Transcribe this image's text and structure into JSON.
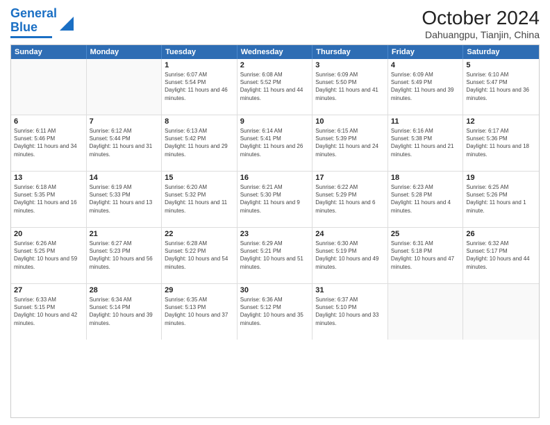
{
  "header": {
    "logo_general": "General",
    "logo_blue": "Blue",
    "title": "October 2024",
    "subtitle": "Dahuangpu, Tianjin, China"
  },
  "days": [
    "Sunday",
    "Monday",
    "Tuesday",
    "Wednesday",
    "Thursday",
    "Friday",
    "Saturday"
  ],
  "weeks": [
    [
      {
        "day": "",
        "info": ""
      },
      {
        "day": "",
        "info": ""
      },
      {
        "day": "1",
        "info": "Sunrise: 6:07 AM\nSunset: 5:54 PM\nDaylight: 11 hours and 46 minutes."
      },
      {
        "day": "2",
        "info": "Sunrise: 6:08 AM\nSunset: 5:52 PM\nDaylight: 11 hours and 44 minutes."
      },
      {
        "day": "3",
        "info": "Sunrise: 6:09 AM\nSunset: 5:50 PM\nDaylight: 11 hours and 41 minutes."
      },
      {
        "day": "4",
        "info": "Sunrise: 6:09 AM\nSunset: 5:49 PM\nDaylight: 11 hours and 39 minutes."
      },
      {
        "day": "5",
        "info": "Sunrise: 6:10 AM\nSunset: 5:47 PM\nDaylight: 11 hours and 36 minutes."
      }
    ],
    [
      {
        "day": "6",
        "info": "Sunrise: 6:11 AM\nSunset: 5:46 PM\nDaylight: 11 hours and 34 minutes."
      },
      {
        "day": "7",
        "info": "Sunrise: 6:12 AM\nSunset: 5:44 PM\nDaylight: 11 hours and 31 minutes."
      },
      {
        "day": "8",
        "info": "Sunrise: 6:13 AM\nSunset: 5:42 PM\nDaylight: 11 hours and 29 minutes."
      },
      {
        "day": "9",
        "info": "Sunrise: 6:14 AM\nSunset: 5:41 PM\nDaylight: 11 hours and 26 minutes."
      },
      {
        "day": "10",
        "info": "Sunrise: 6:15 AM\nSunset: 5:39 PM\nDaylight: 11 hours and 24 minutes."
      },
      {
        "day": "11",
        "info": "Sunrise: 6:16 AM\nSunset: 5:38 PM\nDaylight: 11 hours and 21 minutes."
      },
      {
        "day": "12",
        "info": "Sunrise: 6:17 AM\nSunset: 5:36 PM\nDaylight: 11 hours and 18 minutes."
      }
    ],
    [
      {
        "day": "13",
        "info": "Sunrise: 6:18 AM\nSunset: 5:35 PM\nDaylight: 11 hours and 16 minutes."
      },
      {
        "day": "14",
        "info": "Sunrise: 6:19 AM\nSunset: 5:33 PM\nDaylight: 11 hours and 13 minutes."
      },
      {
        "day": "15",
        "info": "Sunrise: 6:20 AM\nSunset: 5:32 PM\nDaylight: 11 hours and 11 minutes."
      },
      {
        "day": "16",
        "info": "Sunrise: 6:21 AM\nSunset: 5:30 PM\nDaylight: 11 hours and 9 minutes."
      },
      {
        "day": "17",
        "info": "Sunrise: 6:22 AM\nSunset: 5:29 PM\nDaylight: 11 hours and 6 minutes."
      },
      {
        "day": "18",
        "info": "Sunrise: 6:23 AM\nSunset: 5:28 PM\nDaylight: 11 hours and 4 minutes."
      },
      {
        "day": "19",
        "info": "Sunrise: 6:25 AM\nSunset: 5:26 PM\nDaylight: 11 hours and 1 minute."
      }
    ],
    [
      {
        "day": "20",
        "info": "Sunrise: 6:26 AM\nSunset: 5:25 PM\nDaylight: 10 hours and 59 minutes."
      },
      {
        "day": "21",
        "info": "Sunrise: 6:27 AM\nSunset: 5:23 PM\nDaylight: 10 hours and 56 minutes."
      },
      {
        "day": "22",
        "info": "Sunrise: 6:28 AM\nSunset: 5:22 PM\nDaylight: 10 hours and 54 minutes."
      },
      {
        "day": "23",
        "info": "Sunrise: 6:29 AM\nSunset: 5:21 PM\nDaylight: 10 hours and 51 minutes."
      },
      {
        "day": "24",
        "info": "Sunrise: 6:30 AM\nSunset: 5:19 PM\nDaylight: 10 hours and 49 minutes."
      },
      {
        "day": "25",
        "info": "Sunrise: 6:31 AM\nSunset: 5:18 PM\nDaylight: 10 hours and 47 minutes."
      },
      {
        "day": "26",
        "info": "Sunrise: 6:32 AM\nSunset: 5:17 PM\nDaylight: 10 hours and 44 minutes."
      }
    ],
    [
      {
        "day": "27",
        "info": "Sunrise: 6:33 AM\nSunset: 5:15 PM\nDaylight: 10 hours and 42 minutes."
      },
      {
        "day": "28",
        "info": "Sunrise: 6:34 AM\nSunset: 5:14 PM\nDaylight: 10 hours and 39 minutes."
      },
      {
        "day": "29",
        "info": "Sunrise: 6:35 AM\nSunset: 5:13 PM\nDaylight: 10 hours and 37 minutes."
      },
      {
        "day": "30",
        "info": "Sunrise: 6:36 AM\nSunset: 5:12 PM\nDaylight: 10 hours and 35 minutes."
      },
      {
        "day": "31",
        "info": "Sunrise: 6:37 AM\nSunset: 5:10 PM\nDaylight: 10 hours and 33 minutes."
      },
      {
        "day": "",
        "info": ""
      },
      {
        "day": "",
        "info": ""
      }
    ]
  ]
}
